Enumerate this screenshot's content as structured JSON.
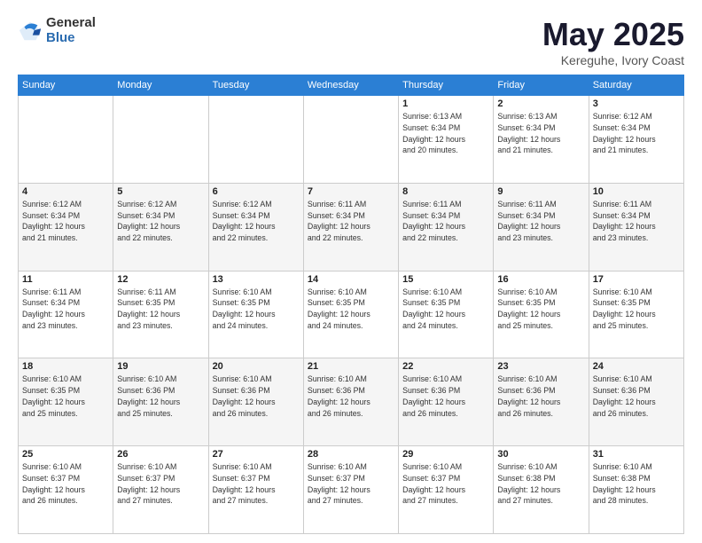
{
  "logo": {
    "general": "General",
    "blue": "Blue"
  },
  "title": {
    "month": "May 2025",
    "location": "Kereguhe, Ivory Coast"
  },
  "days_header": [
    "Sunday",
    "Monday",
    "Tuesday",
    "Wednesday",
    "Thursday",
    "Friday",
    "Saturday"
  ],
  "weeks": [
    [
      {
        "day": "",
        "info": ""
      },
      {
        "day": "",
        "info": ""
      },
      {
        "day": "",
        "info": ""
      },
      {
        "day": "",
        "info": ""
      },
      {
        "day": "1",
        "info": "Sunrise: 6:13 AM\nSunset: 6:34 PM\nDaylight: 12 hours\nand 20 minutes."
      },
      {
        "day": "2",
        "info": "Sunrise: 6:13 AM\nSunset: 6:34 PM\nDaylight: 12 hours\nand 21 minutes."
      },
      {
        "day": "3",
        "info": "Sunrise: 6:12 AM\nSunset: 6:34 PM\nDaylight: 12 hours\nand 21 minutes."
      }
    ],
    [
      {
        "day": "4",
        "info": "Sunrise: 6:12 AM\nSunset: 6:34 PM\nDaylight: 12 hours\nand 21 minutes."
      },
      {
        "day": "5",
        "info": "Sunrise: 6:12 AM\nSunset: 6:34 PM\nDaylight: 12 hours\nand 22 minutes."
      },
      {
        "day": "6",
        "info": "Sunrise: 6:12 AM\nSunset: 6:34 PM\nDaylight: 12 hours\nand 22 minutes."
      },
      {
        "day": "7",
        "info": "Sunrise: 6:11 AM\nSunset: 6:34 PM\nDaylight: 12 hours\nand 22 minutes."
      },
      {
        "day": "8",
        "info": "Sunrise: 6:11 AM\nSunset: 6:34 PM\nDaylight: 12 hours\nand 22 minutes."
      },
      {
        "day": "9",
        "info": "Sunrise: 6:11 AM\nSunset: 6:34 PM\nDaylight: 12 hours\nand 23 minutes."
      },
      {
        "day": "10",
        "info": "Sunrise: 6:11 AM\nSunset: 6:34 PM\nDaylight: 12 hours\nand 23 minutes."
      }
    ],
    [
      {
        "day": "11",
        "info": "Sunrise: 6:11 AM\nSunset: 6:34 PM\nDaylight: 12 hours\nand 23 minutes."
      },
      {
        "day": "12",
        "info": "Sunrise: 6:11 AM\nSunset: 6:35 PM\nDaylight: 12 hours\nand 23 minutes."
      },
      {
        "day": "13",
        "info": "Sunrise: 6:10 AM\nSunset: 6:35 PM\nDaylight: 12 hours\nand 24 minutes."
      },
      {
        "day": "14",
        "info": "Sunrise: 6:10 AM\nSunset: 6:35 PM\nDaylight: 12 hours\nand 24 minutes."
      },
      {
        "day": "15",
        "info": "Sunrise: 6:10 AM\nSunset: 6:35 PM\nDaylight: 12 hours\nand 24 minutes."
      },
      {
        "day": "16",
        "info": "Sunrise: 6:10 AM\nSunset: 6:35 PM\nDaylight: 12 hours\nand 25 minutes."
      },
      {
        "day": "17",
        "info": "Sunrise: 6:10 AM\nSunset: 6:35 PM\nDaylight: 12 hours\nand 25 minutes."
      }
    ],
    [
      {
        "day": "18",
        "info": "Sunrise: 6:10 AM\nSunset: 6:35 PM\nDaylight: 12 hours\nand 25 minutes."
      },
      {
        "day": "19",
        "info": "Sunrise: 6:10 AM\nSunset: 6:36 PM\nDaylight: 12 hours\nand 25 minutes."
      },
      {
        "day": "20",
        "info": "Sunrise: 6:10 AM\nSunset: 6:36 PM\nDaylight: 12 hours\nand 26 minutes."
      },
      {
        "day": "21",
        "info": "Sunrise: 6:10 AM\nSunset: 6:36 PM\nDaylight: 12 hours\nand 26 minutes."
      },
      {
        "day": "22",
        "info": "Sunrise: 6:10 AM\nSunset: 6:36 PM\nDaylight: 12 hours\nand 26 minutes."
      },
      {
        "day": "23",
        "info": "Sunrise: 6:10 AM\nSunset: 6:36 PM\nDaylight: 12 hours\nand 26 minutes."
      },
      {
        "day": "24",
        "info": "Sunrise: 6:10 AM\nSunset: 6:36 PM\nDaylight: 12 hours\nand 26 minutes."
      }
    ],
    [
      {
        "day": "25",
        "info": "Sunrise: 6:10 AM\nSunset: 6:37 PM\nDaylight: 12 hours\nand 26 minutes."
      },
      {
        "day": "26",
        "info": "Sunrise: 6:10 AM\nSunset: 6:37 PM\nDaylight: 12 hours\nand 27 minutes."
      },
      {
        "day": "27",
        "info": "Sunrise: 6:10 AM\nSunset: 6:37 PM\nDaylight: 12 hours\nand 27 minutes."
      },
      {
        "day": "28",
        "info": "Sunrise: 6:10 AM\nSunset: 6:37 PM\nDaylight: 12 hours\nand 27 minutes."
      },
      {
        "day": "29",
        "info": "Sunrise: 6:10 AM\nSunset: 6:37 PM\nDaylight: 12 hours\nand 27 minutes."
      },
      {
        "day": "30",
        "info": "Sunrise: 6:10 AM\nSunset: 6:38 PM\nDaylight: 12 hours\nand 27 minutes."
      },
      {
        "day": "31",
        "info": "Sunrise: 6:10 AM\nSunset: 6:38 PM\nDaylight: 12 hours\nand 28 minutes."
      }
    ]
  ]
}
